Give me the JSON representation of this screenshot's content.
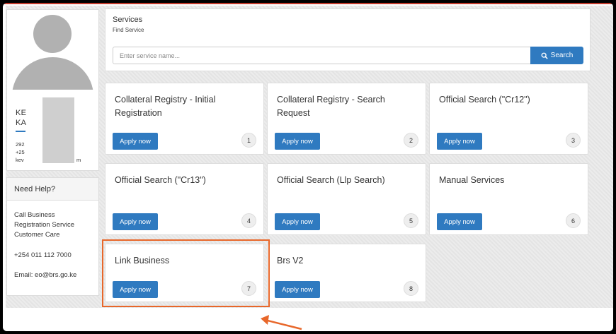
{
  "profile": {
    "name_line1": "KE",
    "name_line2": "KA",
    "info_line1": "292",
    "info_line2": "+25",
    "info_line3_start": "kev",
    "info_line3_end": "m"
  },
  "help": {
    "heading": "Need Help?",
    "line1": "Call Business",
    "line2": "Registration Service",
    "line3": "Customer Care",
    "phone": "+254 011 112 7000",
    "email": "Email: eo@brs.go.ke"
  },
  "services": {
    "title": "Services",
    "subtitle": "Find Service",
    "search_placeholder": "Enter service name...",
    "search_button": "Search"
  },
  "cards": [
    {
      "title": "Collateral Registry - Initial Registration",
      "button": "Apply now",
      "number": "1"
    },
    {
      "title": "Collateral Registry - Search Request",
      "button": "Apply now",
      "number": "2"
    },
    {
      "title": "Official Search (\"Cr12\")",
      "button": "Apply now",
      "number": "3"
    },
    {
      "title": "Official Search (\"Cr13\")",
      "button": "Apply now",
      "number": "4"
    },
    {
      "title": "Official Search (Llp Search)",
      "button": "Apply now",
      "number": "5"
    },
    {
      "title": "Manual Services",
      "button": "Apply now",
      "number": "6"
    },
    {
      "title": "Link Business",
      "button": "Apply now",
      "number": "7"
    },
    {
      "title": "Brs V2",
      "button": "Apply now",
      "number": "8"
    }
  ],
  "colors": {
    "accent": "#2f7ac0",
    "highlight": "#e8672a"
  }
}
